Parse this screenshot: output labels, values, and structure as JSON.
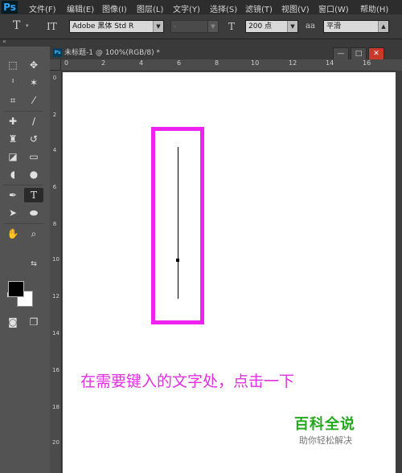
{
  "app": {
    "logo": "Ps"
  },
  "menu": [
    "文件(F)",
    "编辑(E)",
    "图像(I)",
    "图层(L)",
    "文字(Y)",
    "选择(S)",
    "滤镜(T)",
    "视图(V)",
    "窗口(W)",
    "帮助(H)"
  ],
  "options": {
    "tool_icon": "T",
    "orient_icon": "IT",
    "font_family": "Adobe 黑体 Std R",
    "font_style": "-",
    "size_icon": "T",
    "font_size": "200 点",
    "aa_icon": "aa",
    "antialias": "平滑"
  },
  "document": {
    "tab_title": "未标题-1 @ 100%(RGB/8) *",
    "tab_icon": "Ps"
  },
  "ruler": {
    "h_labels": [
      "0",
      "2",
      "4",
      "6",
      "8",
      "10",
      "12",
      "14",
      "16"
    ],
    "v_labels": [
      "0",
      "2",
      "4",
      "6",
      "8",
      "10",
      "12",
      "14",
      "16",
      "18",
      "20"
    ]
  },
  "canvas": {
    "annotation": "在需要键入的文字处，点击一下",
    "highlight_color": "#ef23ef"
  },
  "watermark": {
    "title": "百科全说",
    "subtitle": "助你轻松解决"
  },
  "colors": {
    "foreground": "#000000",
    "background": "#ffffff",
    "annotation": "#e030e0",
    "watermark": "#24a81c"
  },
  "window_buttons": [
    "—",
    "□",
    "✕"
  ]
}
